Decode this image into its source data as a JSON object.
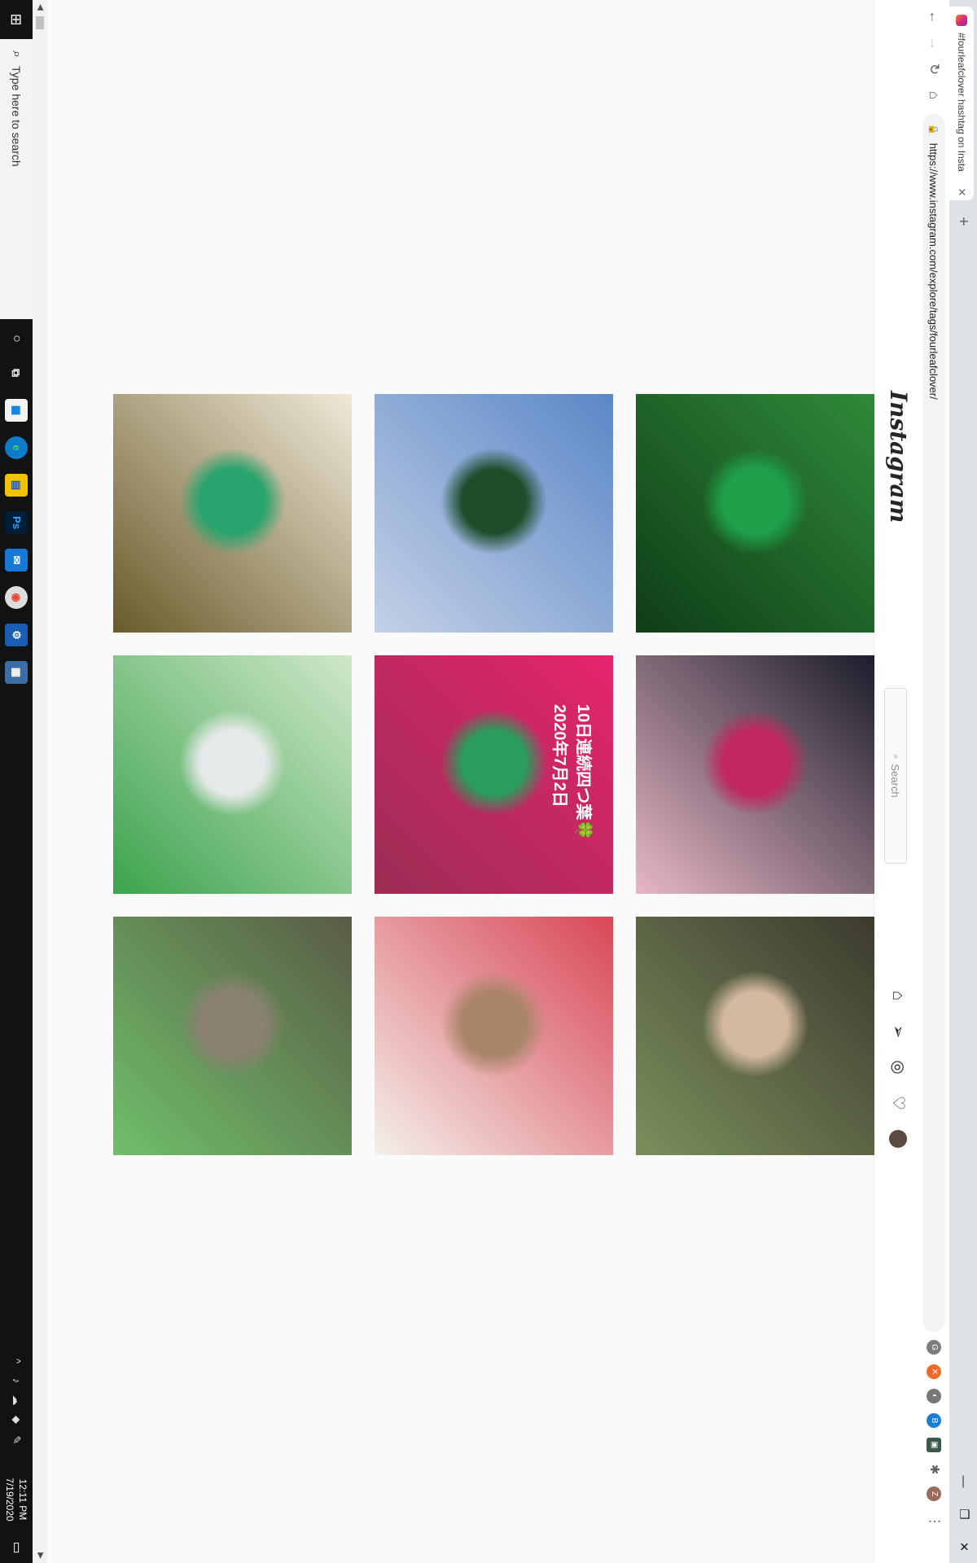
{
  "browser": {
    "tab_title": "#fourleafclover hashtag on Insta",
    "tab_close": "✕",
    "new_tab": "+",
    "url": "https://www.instagram.com/explore/tags/fourleafclover/",
    "window_controls": [
      "—",
      "❐",
      "✕"
    ]
  },
  "instagram": {
    "logo": "Instagram",
    "search_placeholder": "Search",
    "nav_icons": [
      "home-icon",
      "direct-icon",
      "explore-icon",
      "activity-icon",
      "profile-avatar"
    ]
  },
  "posts": [
    {
      "caption": "",
      "colors": [
        "#2f8a3a",
        "#0f3d16",
        "#1fa14a"
      ],
      "row": 0,
      "col": 0
    },
    {
      "caption": "",
      "colors": [
        "#1c1d2b",
        "#e8b7c6",
        "#c0285f"
      ],
      "row": 0,
      "col": 1
    },
    {
      "caption": "",
      "colors": [
        "#3d3a2f",
        "#7a8f5a",
        "#d4b9a0"
      ],
      "row": 0,
      "col": 2
    },
    {
      "caption": "",
      "colors": [
        "#ffffff",
        "#2f7a2d",
        "#b12d3c"
      ],
      "row": 0,
      "col": 3
    },
    {
      "caption": "",
      "colors": [
        "#5b87c7",
        "#c3d1e6",
        "#1f4d2c"
      ],
      "row": 1,
      "col": 0
    },
    {
      "caption": "10日連続四つ葉🍀 2020年7月2日",
      "colors": [
        "#e5246d",
        "#9c2d55",
        "#2a9c5c"
      ],
      "row": 1,
      "col": 1
    },
    {
      "caption": "",
      "colors": [
        "#d94655",
        "#f3f0ea",
        "#a9856a"
      ],
      "row": 1,
      "col": 2
    },
    {
      "caption": "",
      "colors": [
        "#e8e4dd",
        "#3a3833",
        "#6aa84f"
      ],
      "row": 1,
      "col": 3
    },
    {
      "caption": "",
      "colors": [
        "#efe9d7",
        "#6a5a2a",
        "#27a36e"
      ],
      "row": 2,
      "col": 0
    },
    {
      "caption": "",
      "colors": [
        "#cfe8c8",
        "#3ca34e",
        "#e6e9ea"
      ],
      "row": 2,
      "col": 1
    },
    {
      "caption": "",
      "colors": [
        "#5a5c45",
        "#6fbf6a",
        "#8a8172"
      ],
      "row": 2,
      "col": 2
    },
    {
      "caption": "",
      "colors": [
        "#e8e8ea",
        "#2e7a30",
        "#d27a6c"
      ],
      "row": 2,
      "col": 3
    }
  ],
  "taskbar": {
    "search_placeholder": "Type here to search",
    "time": "12:11 PM",
    "date": "7/19/2020"
  }
}
